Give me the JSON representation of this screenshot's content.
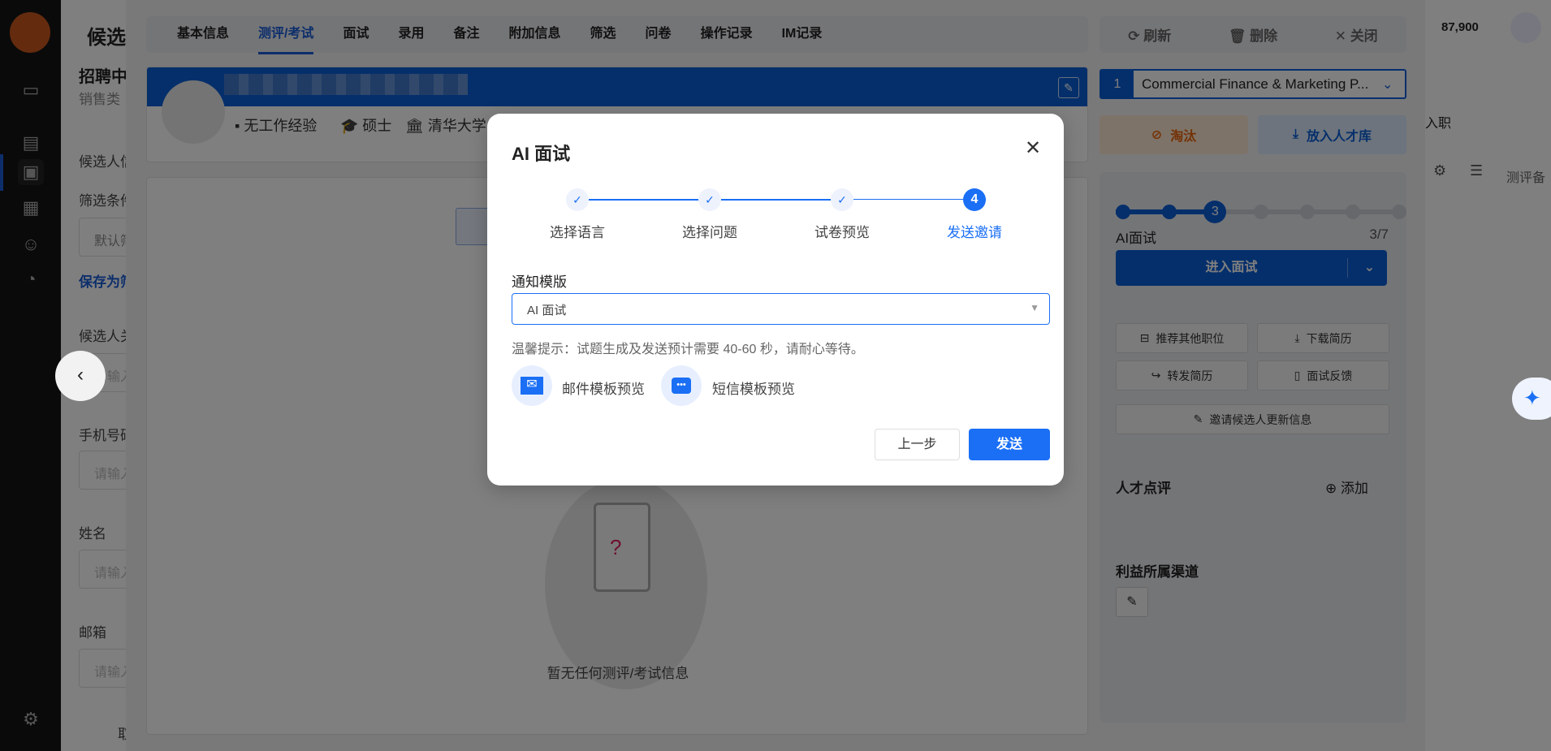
{
  "background": {
    "page_title": "候选人",
    "job_title": "招聘中",
    "job_sub": "销售类",
    "section1": "候选人信息",
    "filter_label": "筛选条件",
    "filter_value": "默认筛选",
    "save_link": "保存为筛选",
    "field_keyword": "候选人关键词",
    "field_phone": "手机号码",
    "field_name": "姓名",
    "field_email": "邮箱",
    "placeholder": "请输入",
    "count": "87,900",
    "status_col": "入职",
    "col_eval": "测评备",
    "bottom_btn": "取"
  },
  "drawer": {
    "tabs": [
      {
        "label": "基本信息"
      },
      {
        "label": "测评/考试",
        "active": true
      },
      {
        "label": "面试"
      },
      {
        "label": "录用"
      },
      {
        "label": "备注"
      },
      {
        "label": "附加信息"
      },
      {
        "label": "筛选"
      },
      {
        "label": "问卷"
      },
      {
        "label": "操作记录"
      },
      {
        "label": "IM记录"
      }
    ],
    "profile": {
      "experience": "无工作经验",
      "degree": "硕士",
      "school": "清华大学"
    },
    "empty_text": "暂无任何测评/考试信息"
  },
  "right_panel": {
    "refresh": "刷新",
    "delete": "删除",
    "close": "关闭",
    "job_index": "1",
    "job_name": "Commercial Finance & Marketing P...",
    "reject": "淘汰",
    "talent_pool": "放入人才库",
    "stage_current": 3,
    "stage_total": 7,
    "stage_name": "AI面试",
    "stage_progress": "3/7",
    "enter_interview": "进入面试",
    "recommend": "推荐其他职位",
    "download": "下载简历",
    "forward": "转发简历",
    "feedback": "面试反馈",
    "invite_update": "邀请候选人更新信息",
    "review_title": "人才点评",
    "add": "添加",
    "channel_title": "利益所属渠道"
  },
  "modal": {
    "title": "AI 面试",
    "steps": [
      {
        "label": "选择语言",
        "done": true
      },
      {
        "label": "选择问题",
        "done": true
      },
      {
        "label": "试卷预览",
        "done": true
      },
      {
        "label": "发送邀请",
        "number": "4",
        "active": true
      }
    ],
    "template_label": "通知模版",
    "template_value": "AI 面试",
    "hint": "温馨提示：试题生成及发送预计需要 40-60 秒，请耐心等待。",
    "email_preview": "邮件模板预览",
    "sms_preview": "短信模板预览",
    "prev": "上一步",
    "send": "发送"
  },
  "colors": {
    "primary": "#1a6ff5",
    "danger": "#e8640c",
    "nav": "#141414"
  }
}
